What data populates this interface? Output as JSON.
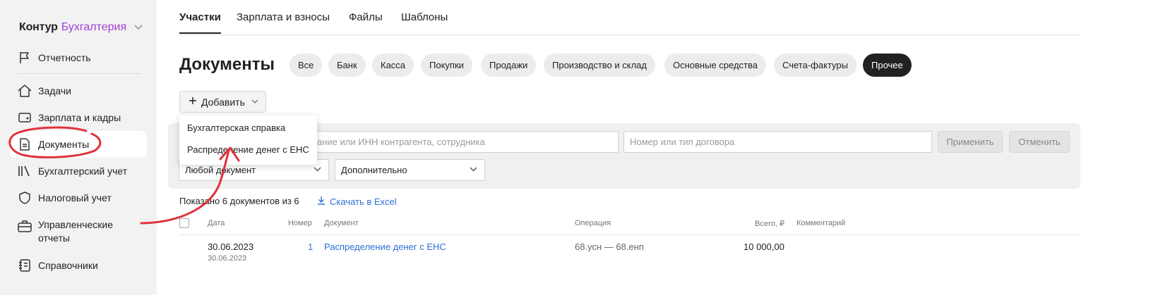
{
  "sidebar": {
    "brand": "Контур",
    "product": "Бухгалтерия",
    "items": [
      {
        "label": "Отчетность",
        "icon": "flag-icon"
      },
      {
        "label": "Задачи",
        "icon": "home-icon"
      },
      {
        "label": "Зарплата и кадры",
        "icon": "wallet-icon"
      },
      {
        "label": "Документы",
        "icon": "document-icon"
      },
      {
        "label": "Бухгалтерский учет",
        "icon": "books-icon"
      },
      {
        "label": "Налоговый учет",
        "icon": "shield-icon"
      },
      {
        "label": "Управленческие\nотчеты",
        "icon": "briefcase-icon"
      },
      {
        "label": "Справочники",
        "icon": "notebook-icon"
      }
    ]
  },
  "tabs": [
    {
      "label": "Участки",
      "active": true
    },
    {
      "label": "Зарплата и взносы",
      "active": false
    },
    {
      "label": "Файлы",
      "active": false
    },
    {
      "label": "Шаблоны",
      "active": false
    }
  ],
  "page_title": "Документы",
  "chips": [
    {
      "label": "Все"
    },
    {
      "label": "Банк"
    },
    {
      "label": "Касса"
    },
    {
      "label": "Покупки"
    },
    {
      "label": "Продажи"
    },
    {
      "label": "Производство и склад"
    },
    {
      "label": "Основные средства"
    },
    {
      "label": "Счета-фактуры"
    },
    {
      "label": "Прочее",
      "active": true
    }
  ],
  "add_button": {
    "label": "Добавить"
  },
  "dropdown": {
    "items": [
      "Бухгалтерская справка",
      "Распределение денег с ЕНС"
    ]
  },
  "filters": {
    "search_placeholder": "ание или ИНН контрагента, сотрудника",
    "contract_placeholder": "Номер или тип договора",
    "apply_label": "Применить",
    "cancel_label": "Отменить",
    "doc_type_value": "Любой документ",
    "extra_value": "Дополнительно"
  },
  "summary": {
    "text": "Показано 6 документов из 6",
    "excel_label": "Скачать в Excel"
  },
  "table": {
    "headers": {
      "date": "Дата",
      "number": "Номер",
      "document": "Документ",
      "operation": "Операция",
      "total": "Всего, ₽",
      "comment": "Комментарий"
    },
    "rows": [
      {
        "date": "30.06.2023",
        "date_sub": "30.06.2023",
        "number": "1",
        "document": "Распределение денег с ЕНС",
        "operation": "68.усн — 68.енп",
        "total": "10 000,00",
        "comment": ""
      }
    ]
  },
  "colors": {
    "accent_link": "#2f6fd6",
    "brand_purple": "#a23ed6",
    "annotation_red": "#e0323b",
    "chip_active": "#222222"
  }
}
